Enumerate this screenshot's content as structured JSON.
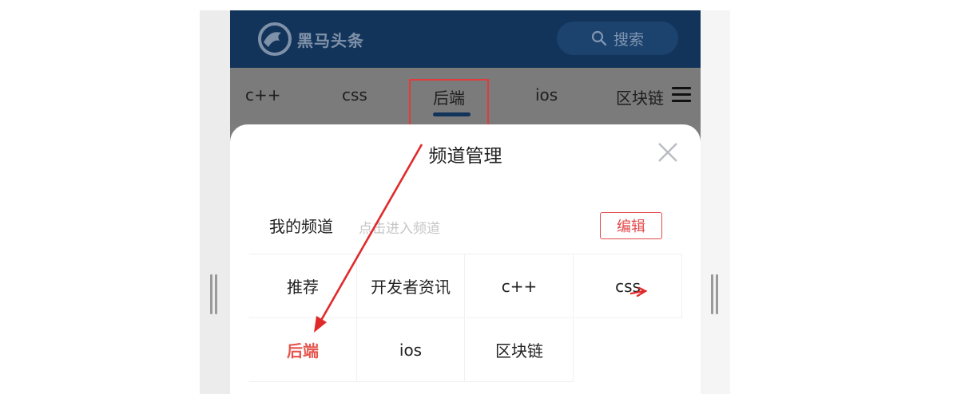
{
  "header": {
    "logo_text": "黑马头条",
    "search_label": "搜索"
  },
  "tabs": [
    {
      "label": "c++"
    },
    {
      "label": "css"
    },
    {
      "label": "后端"
    },
    {
      "label": "ios"
    },
    {
      "label": "区块链"
    }
  ],
  "active_tab": "后端",
  "panel": {
    "title": "频道管理",
    "section_title": "我的频道",
    "section_hint": "点击进入频道",
    "edit_label": "编辑",
    "channels": [
      {
        "label": "推荐"
      },
      {
        "label": "开发者资讯"
      },
      {
        "label": "c++"
      },
      {
        "label": "css"
      },
      {
        "label": "后端"
      },
      {
        "label": "ios"
      },
      {
        "label": "区块链"
      }
    ],
    "active_channel": "后端"
  },
  "colors": {
    "header_bg": "#13345a",
    "accent_red": "#e5554e",
    "annotation_red": "#e02a2a"
  },
  "icons": [
    "logo-icon",
    "search-icon",
    "menu-icon",
    "close-icon"
  ]
}
